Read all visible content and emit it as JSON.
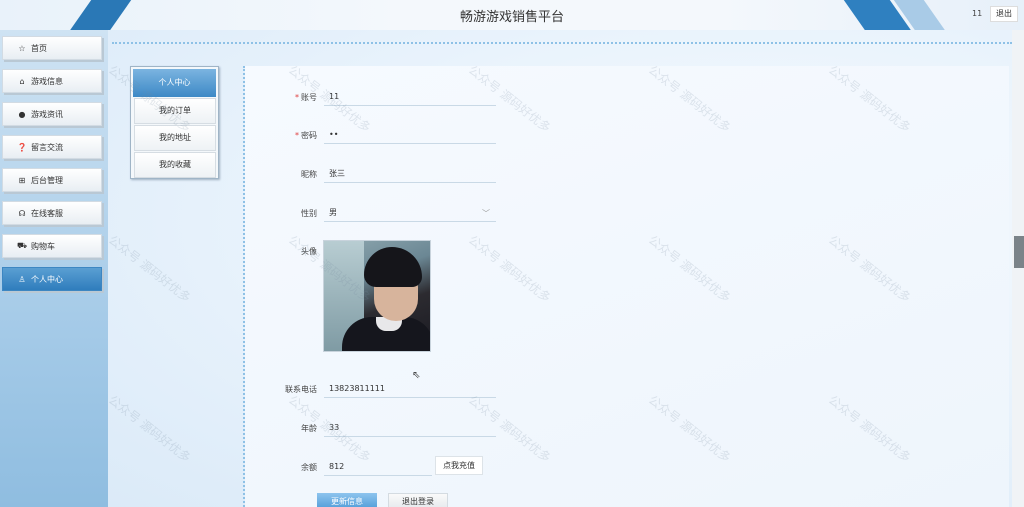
{
  "header": {
    "title": "畅游游戏销售平台",
    "username": "11",
    "logout_label": "退出"
  },
  "sidebar": {
    "items": [
      {
        "label": "首页",
        "icon": "star-icon",
        "glyph": "☆"
      },
      {
        "label": "游戏信息",
        "icon": "bag-icon",
        "glyph": "⌂"
      },
      {
        "label": "游戏资讯",
        "icon": "info-icon",
        "glyph": "●"
      },
      {
        "label": "留言交流",
        "icon": "question-icon",
        "glyph": "❓"
      },
      {
        "label": "后台管理",
        "icon": "gift-icon",
        "glyph": "⊞"
      },
      {
        "label": "在线客服",
        "icon": "headset-icon",
        "glyph": "☊"
      },
      {
        "label": "购物车",
        "icon": "cart-icon",
        "glyph": "⛟"
      },
      {
        "label": "个人中心",
        "icon": "user-icon",
        "glyph": "♙"
      }
    ]
  },
  "submenu": {
    "title": "个人中心",
    "items": [
      "我的订单",
      "我的地址",
      "我的收藏"
    ]
  },
  "form": {
    "account_label": "账号",
    "account_value": "11",
    "password_label": "密码",
    "password_value": "••",
    "nickname_label": "昵称",
    "nickname_value": "张三",
    "gender_label": "性别",
    "gender_value": "男",
    "avatar_label": "头像",
    "phone_label": "联系电话",
    "phone_value": "13823811111",
    "age_label": "年龄",
    "age_value": "33",
    "balance_label": "余额",
    "balance_value": "812",
    "recharge_label": "点我充值",
    "update_label": "更新信息",
    "exit_label": "退出登录"
  },
  "watermark": "公众号 源码好优多"
}
